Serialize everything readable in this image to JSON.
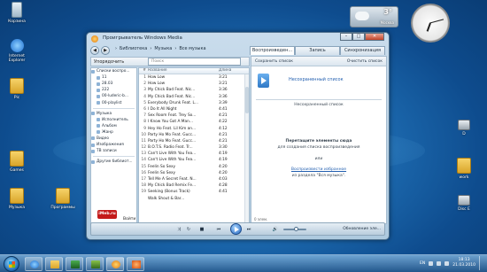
{
  "desktop": {
    "icons": [
      {
        "label": "Корзина",
        "kind": "bin"
      },
      {
        "label": "Internet Explorer",
        "kind": "ie"
      },
      {
        "label": "Pic",
        "kind": "folder"
      },
      {
        "label": "Games",
        "kind": "folder"
      },
      {
        "label": "Музыка",
        "kind": "folder"
      },
      {
        "label": "Программы",
        "kind": "folder"
      },
      {
        "label": "D",
        "kind": "pc"
      },
      {
        "label": "work",
        "kind": "folder"
      },
      {
        "label": "Disc E",
        "kind": "pc"
      }
    ]
  },
  "weather": {
    "temp": "3°",
    "city": "Москва"
  },
  "window": {
    "title": "Проигрыватель Windows Media",
    "breadcrumb": [
      "Библиотека",
      "Музыка",
      "Все музыка"
    ],
    "tabs": [
      "Воспроизведен...",
      "Запись",
      "Синхронизация"
    ],
    "toolbar": {
      "organize": "Упорядочить",
      "create": "Создать список"
    },
    "search_placeholder": "Поиск",
    "list_header": {
      "num": "#",
      "name": "Название",
      "length": "Длина"
    },
    "nav": [
      {
        "label": "Списки воспро..."
      },
      {
        "label": "11"
      },
      {
        "label": "28.03"
      },
      {
        "label": "222"
      },
      {
        "label": "00-luderic-b..."
      },
      {
        "label": "00-playlist"
      },
      {
        "label": "Музыка"
      },
      {
        "label": "Исполнитель"
      },
      {
        "label": "Альбом"
      },
      {
        "label": "Жанр"
      },
      {
        "label": "Видео"
      },
      {
        "label": "Изображения"
      },
      {
        "label": "ТВ записи"
      },
      {
        "label": "Другие библиот..."
      }
    ],
    "logo": "iMeb.ru",
    "tracks": [
      {
        "n": "",
        "name": "Название",
        "len": "Длина"
      },
      {
        "n": "1",
        "name": "How Low",
        "len": "3:21"
      },
      {
        "n": "2",
        "name": "How Low",
        "len": "3:21"
      },
      {
        "n": "3",
        "name": "My Chick Bad Feat. Nic...",
        "len": "3:36"
      },
      {
        "n": "4",
        "name": "My Chick Bad Feat. Nic...",
        "len": "3:36"
      },
      {
        "n": "5",
        "name": "Everybody Drunk Feat. L...",
        "len": "3:39"
      },
      {
        "n": "6",
        "name": "I Do It All Night",
        "len": "4:41"
      },
      {
        "n": "7",
        "name": "Sex Room Feat. Trey So...",
        "len": "4:21"
      },
      {
        "n": "8",
        "name": "I Know You Got A Man...",
        "len": "4:22"
      },
      {
        "n": "9",
        "name": "Hey Ho Feat. Lil Kim an...",
        "len": "4:12"
      },
      {
        "n": "10",
        "name": "Party Ho Mo Feat. Gucc...",
        "len": "4:21"
      },
      {
        "n": "11",
        "name": "Party Ho Mo Feat. Gucc...",
        "len": "4:21"
      },
      {
        "n": "12",
        "name": "B.O.T.S. Radio Feat. Tr...",
        "len": "3:30"
      },
      {
        "n": "13",
        "name": "Can't Live With You Fea...",
        "len": "4:19"
      },
      {
        "n": "14",
        "name": "Can't Live With You Fea...",
        "len": "4:19"
      },
      {
        "n": "15",
        "name": "Feelin So Sexy",
        "len": "4:20"
      },
      {
        "n": "16",
        "name": "Feelin So Sexy",
        "len": "4:20"
      },
      {
        "n": "17",
        "name": "Tell Me A Secret Feat. N...",
        "len": "4:03"
      },
      {
        "n": "18",
        "name": "My Chick Bad Remix Fe...",
        "len": "4:28"
      },
      {
        "n": "19",
        "name": "Seeking (Bonus Track)",
        "len": "4:41"
      },
      {
        "n": "",
        "name": "Walk Shout & Bar...",
        "len": ""
      }
    ],
    "playlist_pane": {
      "save": "Сохранить список",
      "clear": "Очистить список",
      "unsaved": "Несохраненный список",
      "header": "Несохраненный список",
      "drag_title": "Перетащите элементы сюда",
      "drag_sub": "для создания списка воспроизведения",
      "or": "или",
      "fav_link": "Воспроизвести избранное",
      "from": "из раздела \"Вся музыка\".",
      "items": "0 элем."
    },
    "nav_footer": "Войти",
    "update": "Обновление эле..."
  },
  "taskbar": {
    "lang": "EN",
    "time": "18:13",
    "date": "21.03.2010"
  }
}
